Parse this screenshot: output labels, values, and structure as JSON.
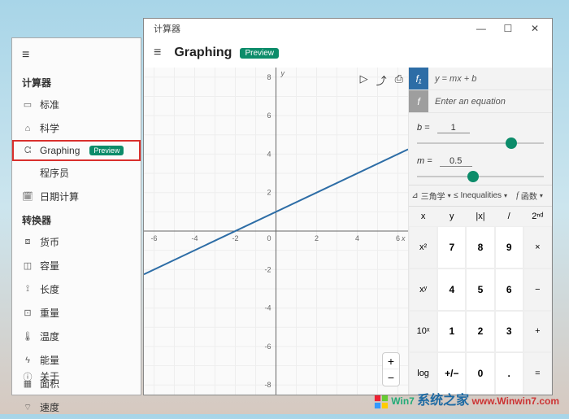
{
  "side": {
    "group1_title": "计算器",
    "items1": [
      {
        "icon": "▭",
        "label": "标准"
      },
      {
        "icon": "⌂",
        "label": "科学"
      },
      {
        "icon": "ᘳ",
        "label": "Graphing",
        "preview": "Preview",
        "highlight": true
      },
      {
        "icon": "</>",
        "label": "程序员"
      },
      {
        "icon": "🗓",
        "label": "日期计算"
      }
    ],
    "group2_title": "转换器",
    "items2": [
      {
        "icon": "⧈",
        "label": "货币"
      },
      {
        "icon": "◫",
        "label": "容量"
      },
      {
        "icon": "⟟",
        "label": "长度"
      },
      {
        "icon": "⊡",
        "label": "重量"
      },
      {
        "icon": "🌡",
        "label": "温度"
      },
      {
        "icon": "ϟ",
        "label": "能量"
      },
      {
        "icon": "▦",
        "label": "面积"
      },
      {
        "icon": "⌔",
        "label": "速度"
      }
    ],
    "about": {
      "icon": "ⓘ",
      "label": "关于"
    }
  },
  "main": {
    "title": "计算器",
    "mode": "Graphing",
    "preview": "Preview",
    "graph_tools": [
      "▷",
      "⤴",
      "⎙"
    ],
    "equations": [
      {
        "f": "f₁",
        "text": "y = mx + b"
      },
      {
        "f": "f",
        "text": "Enter an equation"
      }
    ],
    "sliders": [
      {
        "name": "b",
        "value": "1",
        "pos": 70
      },
      {
        "name": "m",
        "value": "0.5",
        "pos": 40
      }
    ],
    "tabs": [
      {
        "sym": "⊿",
        "label": "三角学"
      },
      {
        "sym": "≤",
        "label": "Inequalities"
      },
      {
        "sym": "f",
        "label": "函数"
      }
    ],
    "speckeys": [
      "x",
      "y",
      "|x|",
      "/",
      "2ⁿᵈ"
    ],
    "pad": [
      [
        "x²",
        "7",
        "8",
        "9",
        "×"
      ],
      [
        "xʸ",
        "4",
        "5",
        "6",
        "−"
      ],
      [
        "10ˣ",
        "1",
        "2",
        "3",
        "+"
      ],
      [
        "log",
        "+/−",
        "0",
        ".",
        "="
      ]
    ]
  },
  "chart_data": {
    "type": "line",
    "title": "",
    "xlabel": "x",
    "ylabel": "y",
    "xlim": [
      -6.5,
      6.5
    ],
    "ylim": [
      -8.5,
      8.5
    ],
    "xticks": [
      -6,
      -4,
      -2,
      0,
      2,
      4,
      6
    ],
    "yticks": [
      -8,
      -6,
      -4,
      -2,
      0,
      2,
      4,
      6,
      8
    ],
    "series": [
      {
        "name": "y = 0.5x + 1",
        "color": "#2d6da6",
        "x": [
          -6.5,
          6.5
        ],
        "y": [
          -2.25,
          4.25
        ]
      }
    ]
  },
  "watermark": {
    "cn": "系统之家",
    "url": "www.Winwin7.com",
    "brand": "Win7"
  }
}
